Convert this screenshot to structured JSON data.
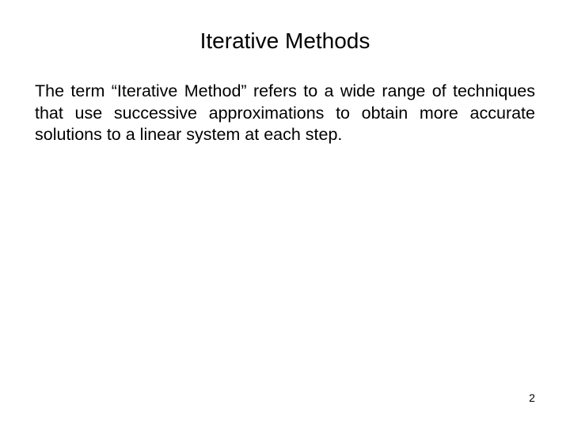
{
  "slide": {
    "title": "Iterative Methods",
    "body": "The term “Iterative Method” refers to a wide range of techniques that use successive approximations to obtain more accurate solutions to a linear system at each step.",
    "page_number": "2"
  }
}
